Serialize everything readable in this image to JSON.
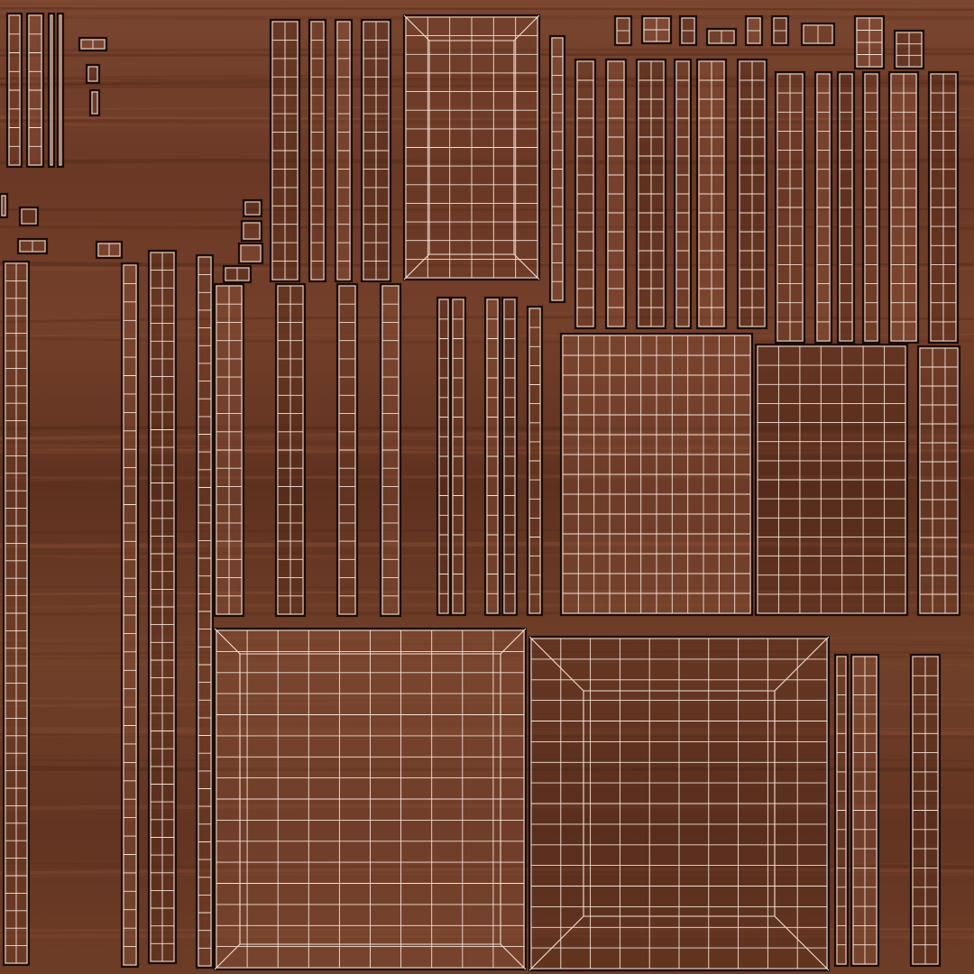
{
  "texture": {
    "colors": {
      "wood_base": "#6b3a25",
      "wood_dark": "#4e2616",
      "wood_light": "#8a5038",
      "island_border": "#1a0d08",
      "wire": "#f2e2d6"
    },
    "island_count": 64
  }
}
